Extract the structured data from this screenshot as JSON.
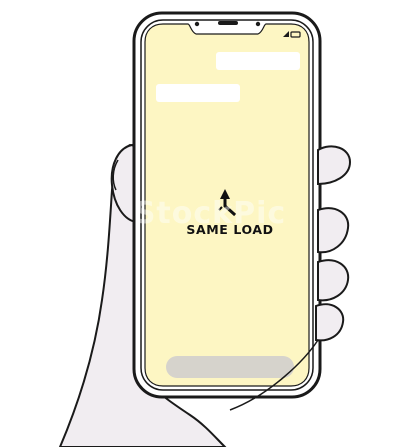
{
  "screen": {
    "message": "SAME LOAD",
    "background_color": "#fdf6c3",
    "icon": "merge-arrow-icon"
  },
  "watermark": {
    "text": "StockPic"
  },
  "colors": {
    "skin": "#f1edf1",
    "outline": "#1a1a1a",
    "phone_frame": "#ffffff",
    "bubble": "#ffffff",
    "home_bar": "#d6d3cc"
  }
}
